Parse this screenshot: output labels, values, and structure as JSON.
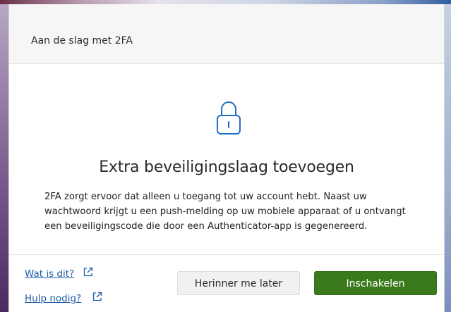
{
  "dialog": {
    "title": "Aan de slag met 2FA",
    "headline": "Extra beveiligingslaag toevoegen",
    "body": "2FA zorgt ervoor dat alleen u toegang tot uw account hebt. Naast uw wachtwoord krijgt u een push-melding op uw mobiele apparaat of u ontvangt een beveiligingscode die door een Authenticator-app is gegenereerd.",
    "icon": "lock-icon"
  },
  "footer": {
    "links": [
      {
        "label": "Wat is dit?",
        "icon": "external-link-icon"
      },
      {
        "label": "Hulp nodig?",
        "icon": "external-link-icon"
      }
    ],
    "buttons": {
      "later_label": "Herinner me later",
      "enable_label": "Inschakelen"
    }
  },
  "colors": {
    "primary_button": "#3a7a1c",
    "link": "#1f5fa8",
    "icon": "#1f6fc4"
  }
}
